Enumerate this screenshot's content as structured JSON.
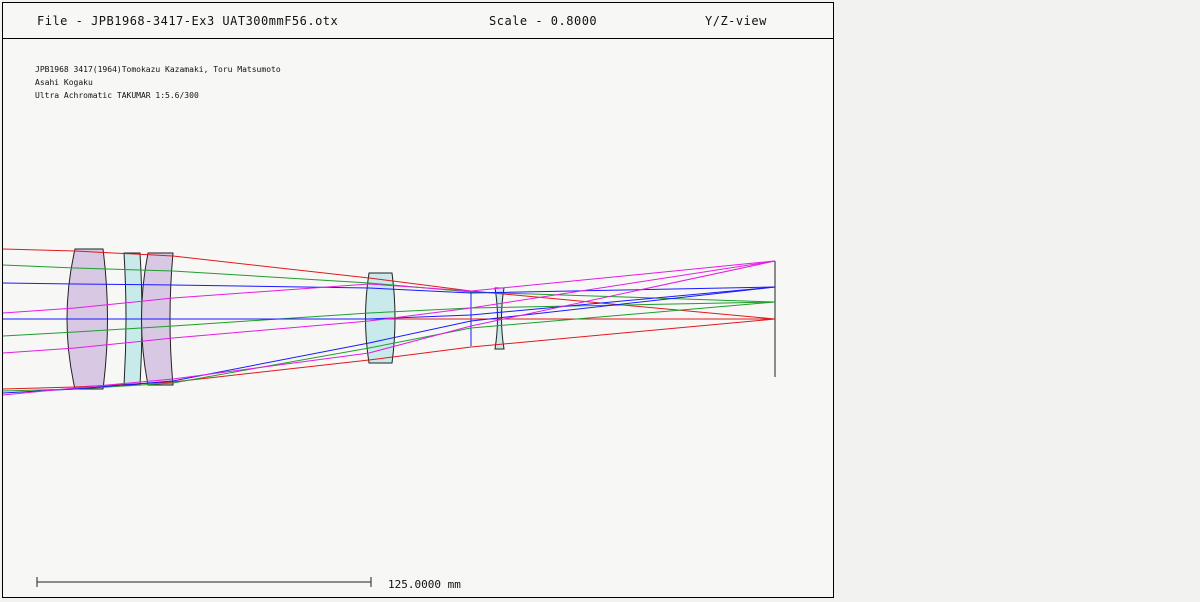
{
  "header": {
    "file_label": "File - JPB1968-3417-Ex3 UAT300mmF56.otx",
    "scale_label": "Scale - 0.8000",
    "view_label": "Y/Z-view"
  },
  "notes": [
    "JPB1968 3417(1964)Tomokazu Kazamaki, Toru Matsumoto",
    "Asahi Kogaku",
    "Ultra Achromatic TAKUMAR 1:5.6/300"
  ],
  "scale_bar": {
    "label": "125.0000 mm"
  },
  "colors": {
    "red": "#e0191e",
    "green": "#1f9e2e",
    "blue": "#1a1aff",
    "magenta": "#e41ce4",
    "lens_fill_purple": "#d8c8e4",
    "lens_fill_cyan": "#c8eaea",
    "outline": "#222222"
  }
}
